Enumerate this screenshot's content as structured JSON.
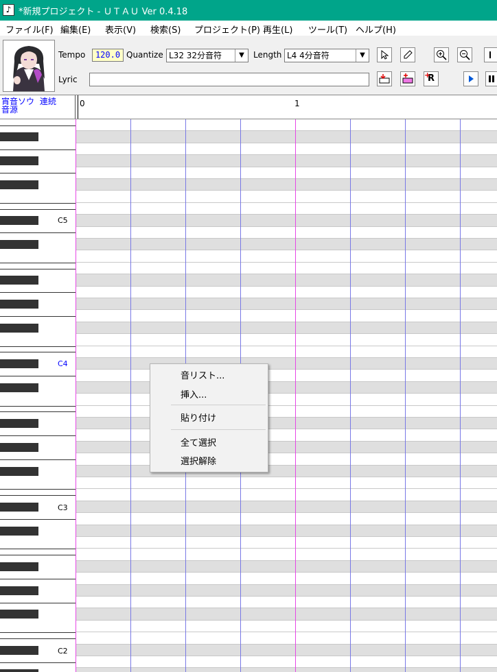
{
  "window": {
    "title": "*新規プロジェクト - ＵＴＡＵ Ver 0.4.18",
    "icon": "music-note-icon"
  },
  "menubar": {
    "items": [
      "ファイル(F)",
      "編集(E)",
      "表示(V)",
      "検索(S)",
      "プロジェクト(P)",
      "再生(L)",
      "ツール(T)",
      "ヘルプ(H)"
    ]
  },
  "toolbar": {
    "tempo_label": "Tempo",
    "tempo_value": "120.0",
    "quantize_label": "Quantize",
    "quantize_value": "L32 32分音符",
    "length_label": "Length",
    "length_value": "L4  4分音符",
    "lyric_label": "Lyric",
    "lyric_value": "",
    "icons": [
      "pointer-tool-icon",
      "pencil-tool-icon",
      "zoom-in-icon",
      "zoom-out-icon",
      "skip-to-start-icon",
      "insert-note-icon",
      "add-note-icon",
      "add-rest-icon",
      "play-icon",
      "pause-icon"
    ],
    "rest_button_label": "R"
  },
  "header": {
    "voice_label": "宵音ソウ",
    "mode_label": "連続",
    "source_label": "音源",
    "measures": [
      "0",
      "1"
    ]
  },
  "keyboard": {
    "labels": [
      "C5",
      "C4",
      "C3",
      "C2"
    ]
  },
  "context_menu": {
    "items": [
      "音リスト...",
      "挿入...",
      "貼り付け",
      "全て選択",
      "選択解除"
    ]
  },
  "colors": {
    "title_bar": "#00a58a",
    "beat_line": "#7878e6",
    "bar_line": "#e646e6",
    "tempo_text": "#0000ff",
    "play_icon": "#0058d8"
  }
}
